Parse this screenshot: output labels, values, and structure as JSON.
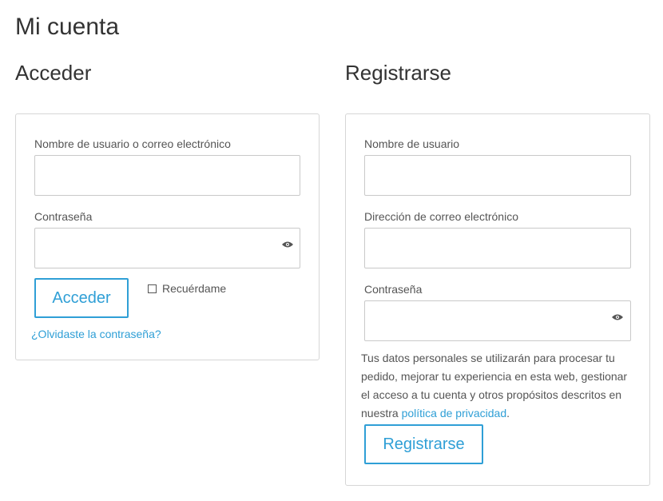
{
  "page": {
    "title": "Mi cuenta"
  },
  "login": {
    "title": "Acceder",
    "username_label": "Nombre de usuario o correo electrónico",
    "username_value": "",
    "password_label": "Contraseña",
    "password_value": "",
    "submit_label": "Acceder",
    "remember_label": "Recuérdame",
    "remember_checked": false,
    "lost_password_label": "¿Olvidaste la contraseña?"
  },
  "register": {
    "title": "Registrarse",
    "username_label": "Nombre de usuario",
    "username_value": "",
    "email_label": "Dirección de correo electrónico",
    "email_value": "",
    "password_label": "Contraseña",
    "password_value": "",
    "privacy_text": "Tus datos personales se utilizarán para procesar tu pedido, mejorar tu experiencia en esta web, gestionar el acceso a tu cuenta y otros propósitos descritos en nuestra ",
    "privacy_link": "política de privacidad",
    "privacy_end": ".",
    "submit_label": "Registrarse"
  },
  "icons": {
    "password_toggle": "eye-icon"
  },
  "colors": {
    "accent": "#2f9fd6",
    "border": "#d6d6d6",
    "text": "#333333"
  }
}
